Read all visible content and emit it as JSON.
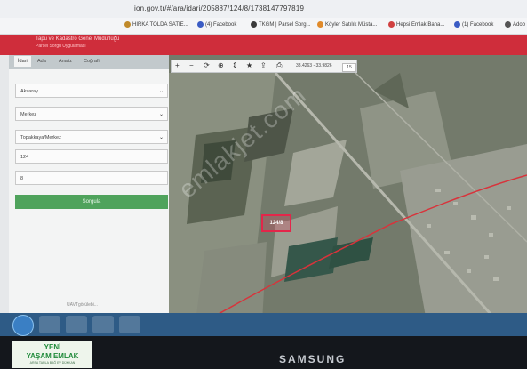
{
  "browser": {
    "url": "ion.gov.tr/#/ara/idari/205887/124/8/1738147797819",
    "bookmarks": [
      {
        "label": "HIRKA TOLDA SATIE...",
        "color": "#c08a2a"
      },
      {
        "label": "(4) Facebook",
        "color": "#3b5cc4"
      },
      {
        "label": "TKGM | Parsel Sorg...",
        "color": "#3a3a3a"
      },
      {
        "label": "Köyler Satılık Müsta...",
        "color": "#e08a2a"
      },
      {
        "label": "Hepsi Emlak Bana...",
        "color": "#d04040"
      },
      {
        "label": "(1) Facebook",
        "color": "#3b5cc4"
      },
      {
        "label": "Adob",
        "color": "#555555"
      }
    ]
  },
  "site": {
    "title": "Tapu ve Kadastro Genel Müdürlüğü",
    "subtitle": "Parsel Sorgu Uygulaması"
  },
  "panel": {
    "tabs": [
      "İdari",
      "Ada",
      "Analiz",
      "Coğrafi"
    ],
    "fields": {
      "province": "Aksaray",
      "district": "Merkez",
      "neighborhood": "Topakkaya/Merkez",
      "block": "124",
      "parcel": "8"
    },
    "query_button": "Sorgula",
    "footer": "UAVTgörülebi..."
  },
  "map": {
    "coords": "38.4263 - 33.9826",
    "zoom": "15",
    "parcel_label": "124/8",
    "watermark": "emlakjet.com"
  },
  "bezel": {
    "brand": "SAMSUNG",
    "logo_line1": "YENİ",
    "logo_line2": "YAŞAM EMLAK",
    "logo_line3": "ARSA TARLA BAĞ EV DÜKKAN"
  }
}
